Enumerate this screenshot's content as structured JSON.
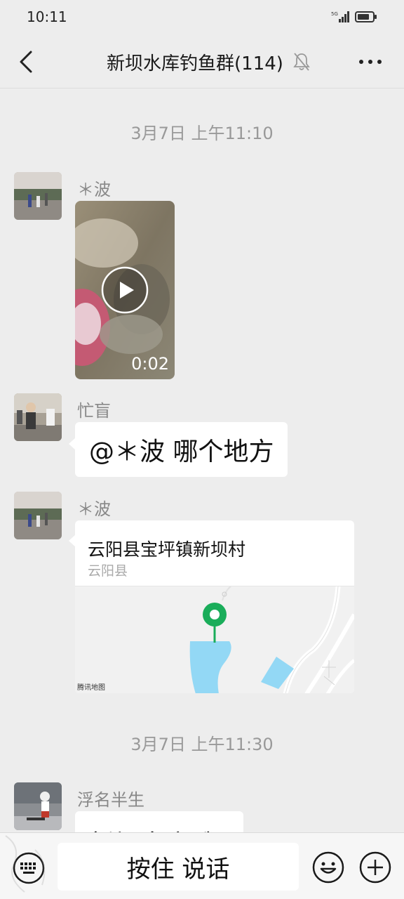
{
  "status_bar": {
    "time": "10:11",
    "signal_icon": "5g-signal-icon",
    "battery_icon": "battery-icon"
  },
  "nav": {
    "title": "新坝水库钓鱼群(114)",
    "back_icon": "chevron-left-icon",
    "mute_icon": "bell-off-icon",
    "more_icon": "more-dots-icon"
  },
  "messages": [
    {
      "type": "timestamp",
      "text": "3月7日 上午11:10"
    },
    {
      "type": "video",
      "sender": "＊波",
      "duration": "0:02"
    },
    {
      "type": "text",
      "sender": "忙盲",
      "text": "@＊波  哪个地方"
    },
    {
      "type": "location",
      "sender": "＊波",
      "name": "云阳县宝坪镇新坝村",
      "subtitle": "云阳县",
      "map_logo": "腾讯地图"
    },
    {
      "type": "timestamp",
      "text": "3月7日 上午11:30"
    },
    {
      "type": "text",
      "sender": "浮名半生",
      "text": "新坝水库哦"
    }
  ],
  "input_bar": {
    "talk_label": "按住 说话",
    "keyboard_icon": "keyboard-icon",
    "emoji_icon": "emoji-icon",
    "plus_icon": "plus-circle-icon"
  },
  "colors": {
    "background": "#ededed",
    "bubble": "#ffffff",
    "map_water": "#93d8f5",
    "map_pin": "#1aad5a"
  }
}
